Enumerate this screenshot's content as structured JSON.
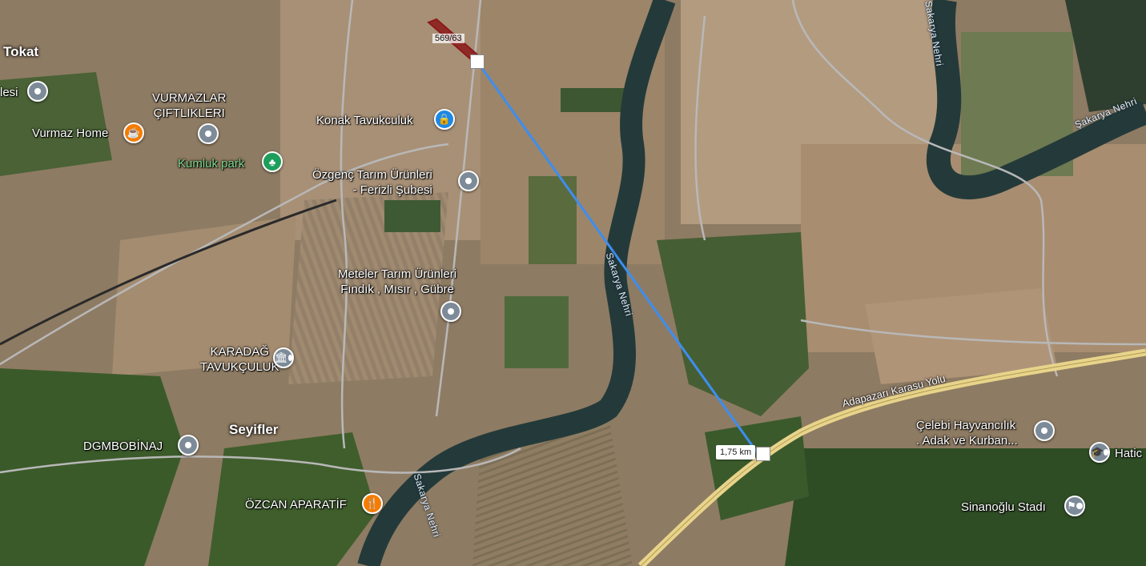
{
  "colors": {
    "measure_line": "#3d8ef0",
    "parcel_outline": "#8b1a1a",
    "river": "#243a3a",
    "highway": "#e8d48a",
    "road": "#b8b8b8"
  },
  "places": {
    "tokat": "Tokat",
    "seyifler": "Seyifler",
    "lesi": "lesi"
  },
  "pois": {
    "vurmazlar_line1": "VURMAZLAR",
    "vurmazlar_line2": "ÇIFTLIKLERI",
    "vurmaz_home": "Vurmaz Home",
    "kumluk_park": "Kumluk park",
    "konak": "Konak Tavukculuk",
    "ozgenc_line1": "Özgenç Tarım Ürünleri",
    "ozgenc_line2": "- Ferizli Şubesi",
    "meteler_line1": "Meteler Tarım Ürünleri",
    "meteler_line2": "Fındık , Mısır , Gübre",
    "karadag_line1": "KARADAĞ",
    "karadag_line2": "TAVUKÇULUK",
    "dgmbobinaj": "DGMBOBİNAJ",
    "ozcan": "ÖZCAN APARATİF",
    "celebi_line1": "Çelebi Hayvancılık",
    "celebi_line2": ". Adak ve Kurban...",
    "sinanoglu": "Sinanoğlu Stadı",
    "hatic": "Hatic"
  },
  "roads": {
    "highway": "Adapazarı Karasu Yolu",
    "river_1": "Sakarya Nehri",
    "river_2": "Sakarya Nehri",
    "river_3": "Şakarya Nehri"
  },
  "measure": {
    "distance": "1,75 km",
    "parcel": "569/63"
  }
}
